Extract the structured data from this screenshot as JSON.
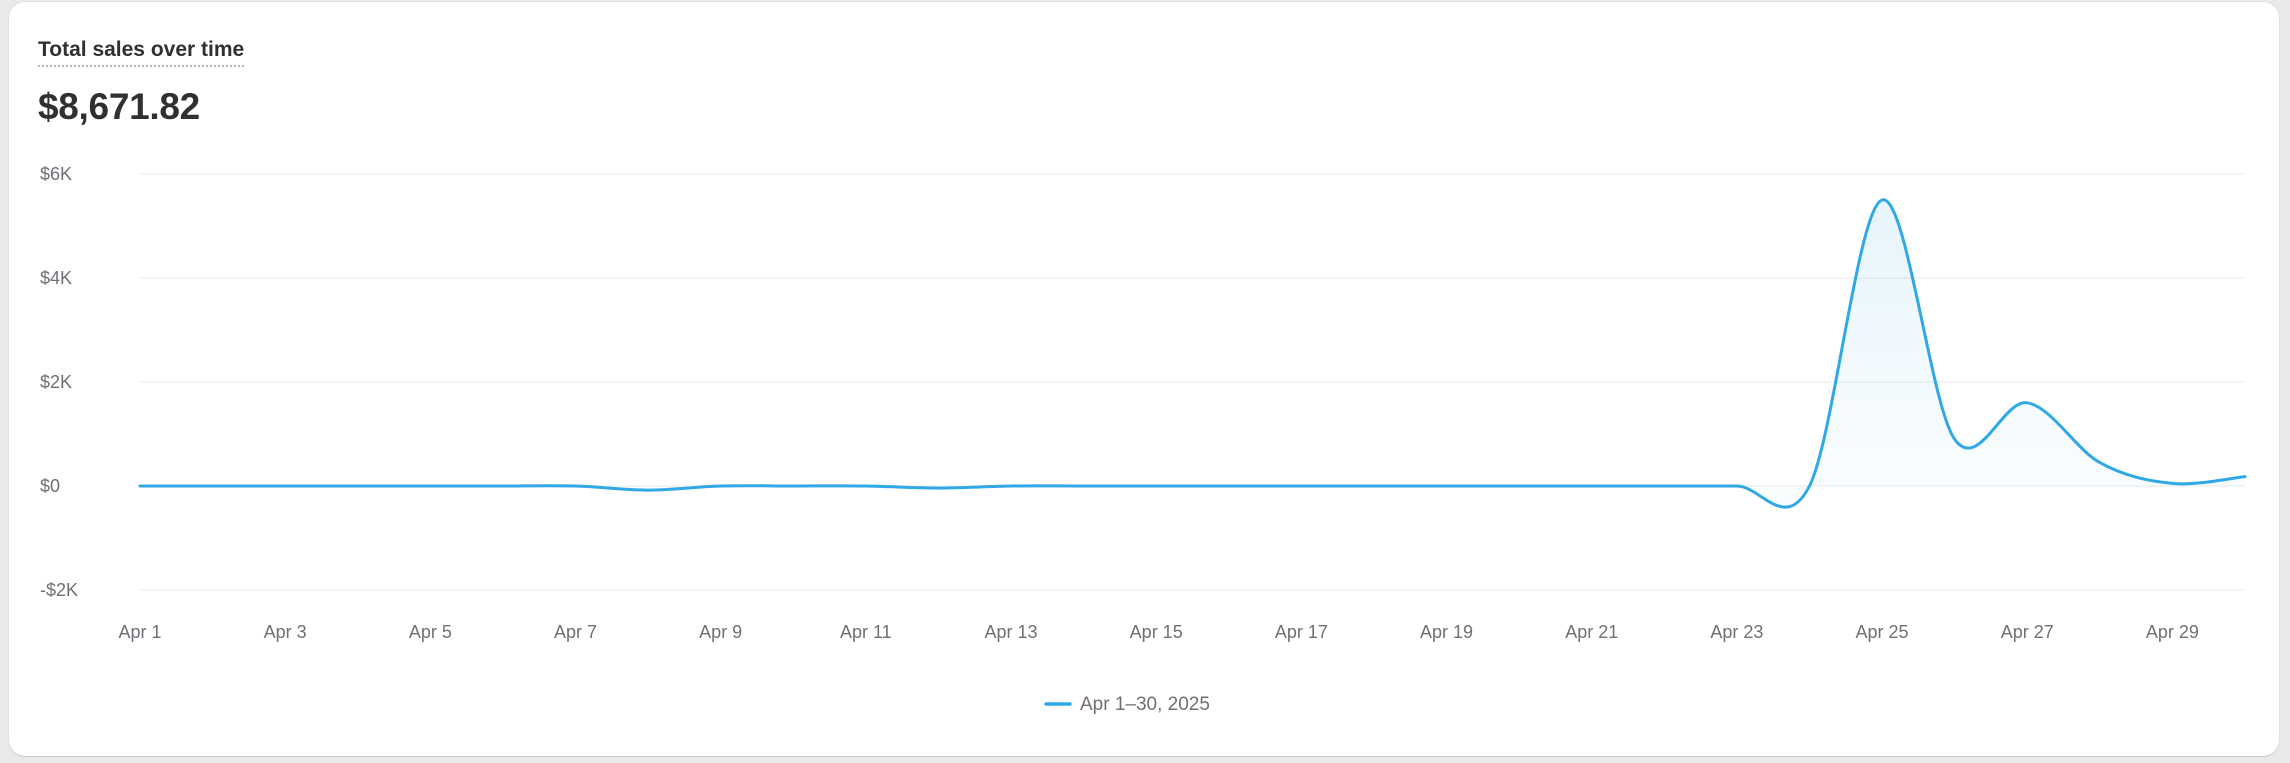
{
  "card": {
    "title": "Total sales over time",
    "total": "$8,671.82"
  },
  "chart_data": {
    "type": "area",
    "title": "Total sales over time",
    "xlabel": "",
    "ylabel": "",
    "x_tick_labels": [
      "Apr 1",
      "Apr 3",
      "Apr 5",
      "Apr 7",
      "Apr 9",
      "Apr 11",
      "Apr 13",
      "Apr 15",
      "Apr 17",
      "Apr 19",
      "Apr 21",
      "Apr 23",
      "Apr 25",
      "Apr 27",
      "Apr 29"
    ],
    "y_ticks": [
      {
        "value": 6000,
        "label": "$6K"
      },
      {
        "value": 4000,
        "label": "$4K"
      },
      {
        "value": 2000,
        "label": "$2K"
      },
      {
        "value": 0,
        "label": "$0"
      },
      {
        "value": -2000,
        "label": "-$2K"
      }
    ],
    "ylim": [
      -2000,
      6000
    ],
    "grid": true,
    "legend_position": "bottom-center",
    "series": [
      {
        "name": "Apr 1–30, 2025",
        "color": "#30a8e6",
        "x": [
          "Apr 1",
          "Apr 2",
          "Apr 3",
          "Apr 4",
          "Apr 5",
          "Apr 6",
          "Apr 7",
          "Apr 8",
          "Apr 9",
          "Apr 10",
          "Apr 11",
          "Apr 12",
          "Apr 13",
          "Apr 14",
          "Apr 15",
          "Apr 16",
          "Apr 17",
          "Apr 18",
          "Apr 19",
          "Apr 20",
          "Apr 21",
          "Apr 22",
          "Apr 23",
          "Apr 24",
          "Apr 25",
          "Apr 26",
          "Apr 27",
          "Apr 28",
          "Apr 29",
          "Apr 30"
        ],
        "values": [
          0,
          0,
          0,
          0,
          0,
          0,
          0,
          -80,
          0,
          0,
          0,
          -40,
          0,
          0,
          0,
          0,
          0,
          0,
          0,
          0,
          0,
          0,
          0,
          0,
          5500,
          900,
          1600,
          450,
          50,
          180
        ]
      }
    ]
  }
}
